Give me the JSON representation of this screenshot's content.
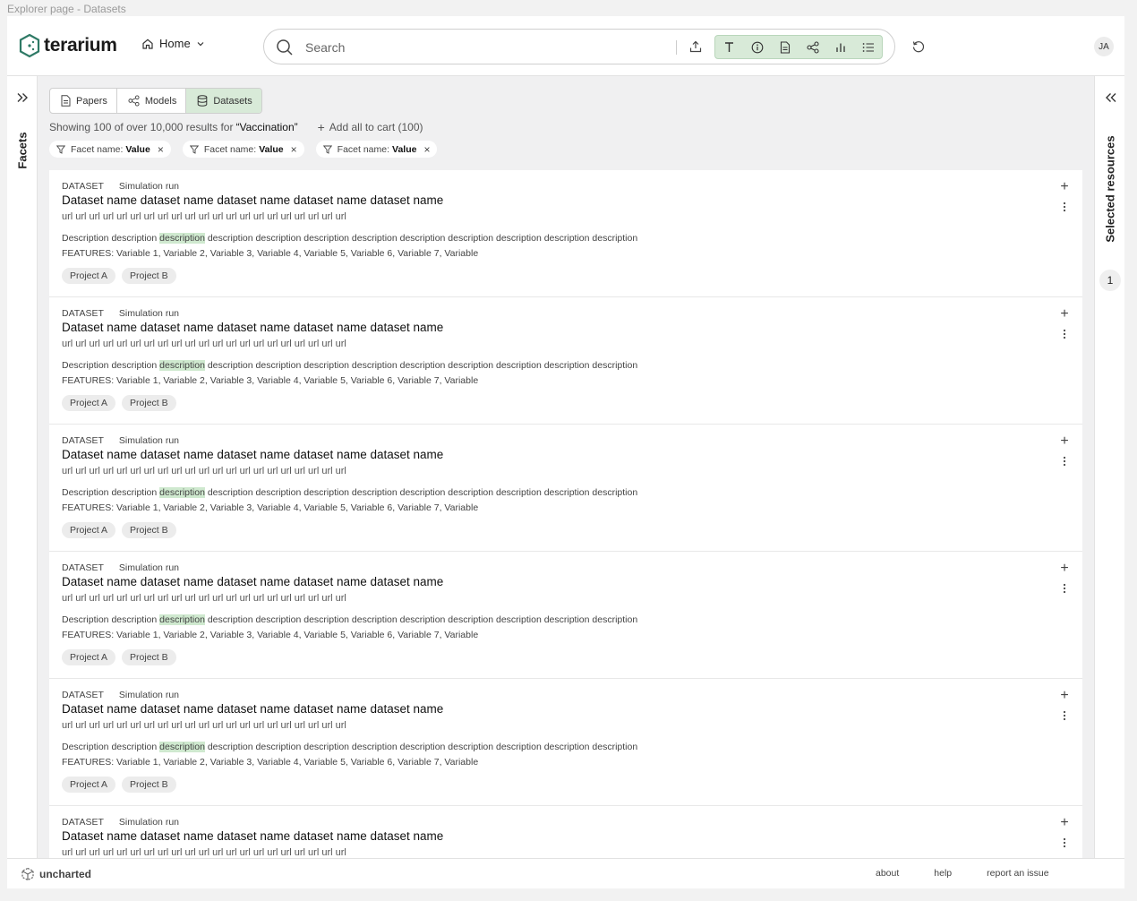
{
  "window_caption": "Explorer page - Datasets",
  "header": {
    "logo_text": "terarium",
    "home_label": "Home",
    "search_placeholder": "Search",
    "avatar_initials": "JA"
  },
  "left_panel": {
    "label": "Facets"
  },
  "right_panel": {
    "label": "Selected resources",
    "count": "1"
  },
  "tabs": [
    {
      "label": "Papers",
      "active": false
    },
    {
      "label": "Models",
      "active": false
    },
    {
      "label": "Datasets",
      "active": true
    }
  ],
  "summary": {
    "prefix": "Showing 100 of over 10,000 results for",
    "query": "“Vaccination”",
    "add_all_label": "Add all to cart (100)"
  },
  "filters": [
    {
      "name": "Facet name:",
      "value": "Value"
    },
    {
      "name": "Facet name:",
      "value": "Value"
    },
    {
      "name": "Facet name:",
      "value": "Value"
    }
  ],
  "result_template": {
    "type": "DATASET",
    "subtype": "Simulation run",
    "title": "Dataset name dataset name dataset name dataset name dataset name",
    "url": "url url url url url url url url url url url url url url url url url url url url url",
    "desc_before": "Description description ",
    "desc_highlight": "description",
    "desc_after": " description description description description description description description description description",
    "features": "FEATURES: Variable 1, Variable 2, Variable 3, Variable 4, Variable 5, Variable 6, Variable 7, Variable",
    "tags": [
      "Project A",
      "Project B"
    ]
  },
  "results_count": 6,
  "footer": {
    "brand": "uncharted",
    "links": [
      "about",
      "help",
      "report an issue"
    ]
  },
  "colors": {
    "accent_green": "#d8ead8",
    "highlight": "#cfe9cf"
  }
}
